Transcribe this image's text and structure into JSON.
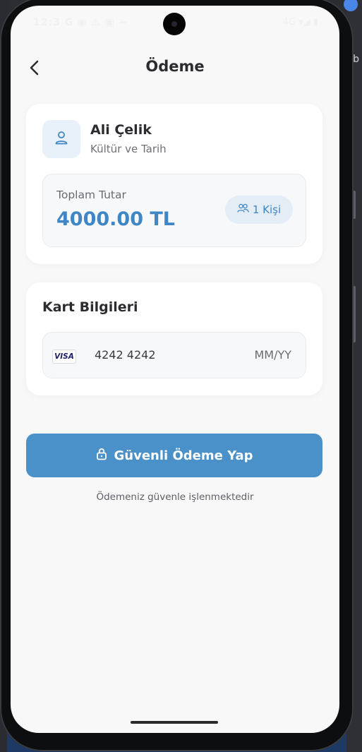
{
  "status_bar": {
    "left": "12:3 G ◉ ⚠ ▣ ~",
    "right": "4G ▾◢ ▮"
  },
  "header": {
    "title": "Ödeme",
    "back_icon": "chevron-left-icon"
  },
  "user_card": {
    "avatar_icon": "user-icon",
    "name": "Ali Çelik",
    "category": "Kültür ve Tarih",
    "total": {
      "label": "Toplam Tutar",
      "amount": "4000.00 TL",
      "people_icon": "users-icon",
      "people": "1 Kişi"
    }
  },
  "card_info": {
    "title": "Kart Bilgileri",
    "brand": "VISA",
    "number": "4242 4242",
    "expiry_placeholder": "MM/YY"
  },
  "pay_button": {
    "icon": "lock-icon",
    "label": "Güvenli Ödeme Yap"
  },
  "secure_note": "Ödemeniz güvenle işlenmektedir",
  "colors": {
    "accent": "#3f86c4",
    "button": "#4a90c9",
    "background": "#f8f8f9",
    "card": "#ffffff"
  },
  "desktop": {
    "edge_text": "b"
  }
}
